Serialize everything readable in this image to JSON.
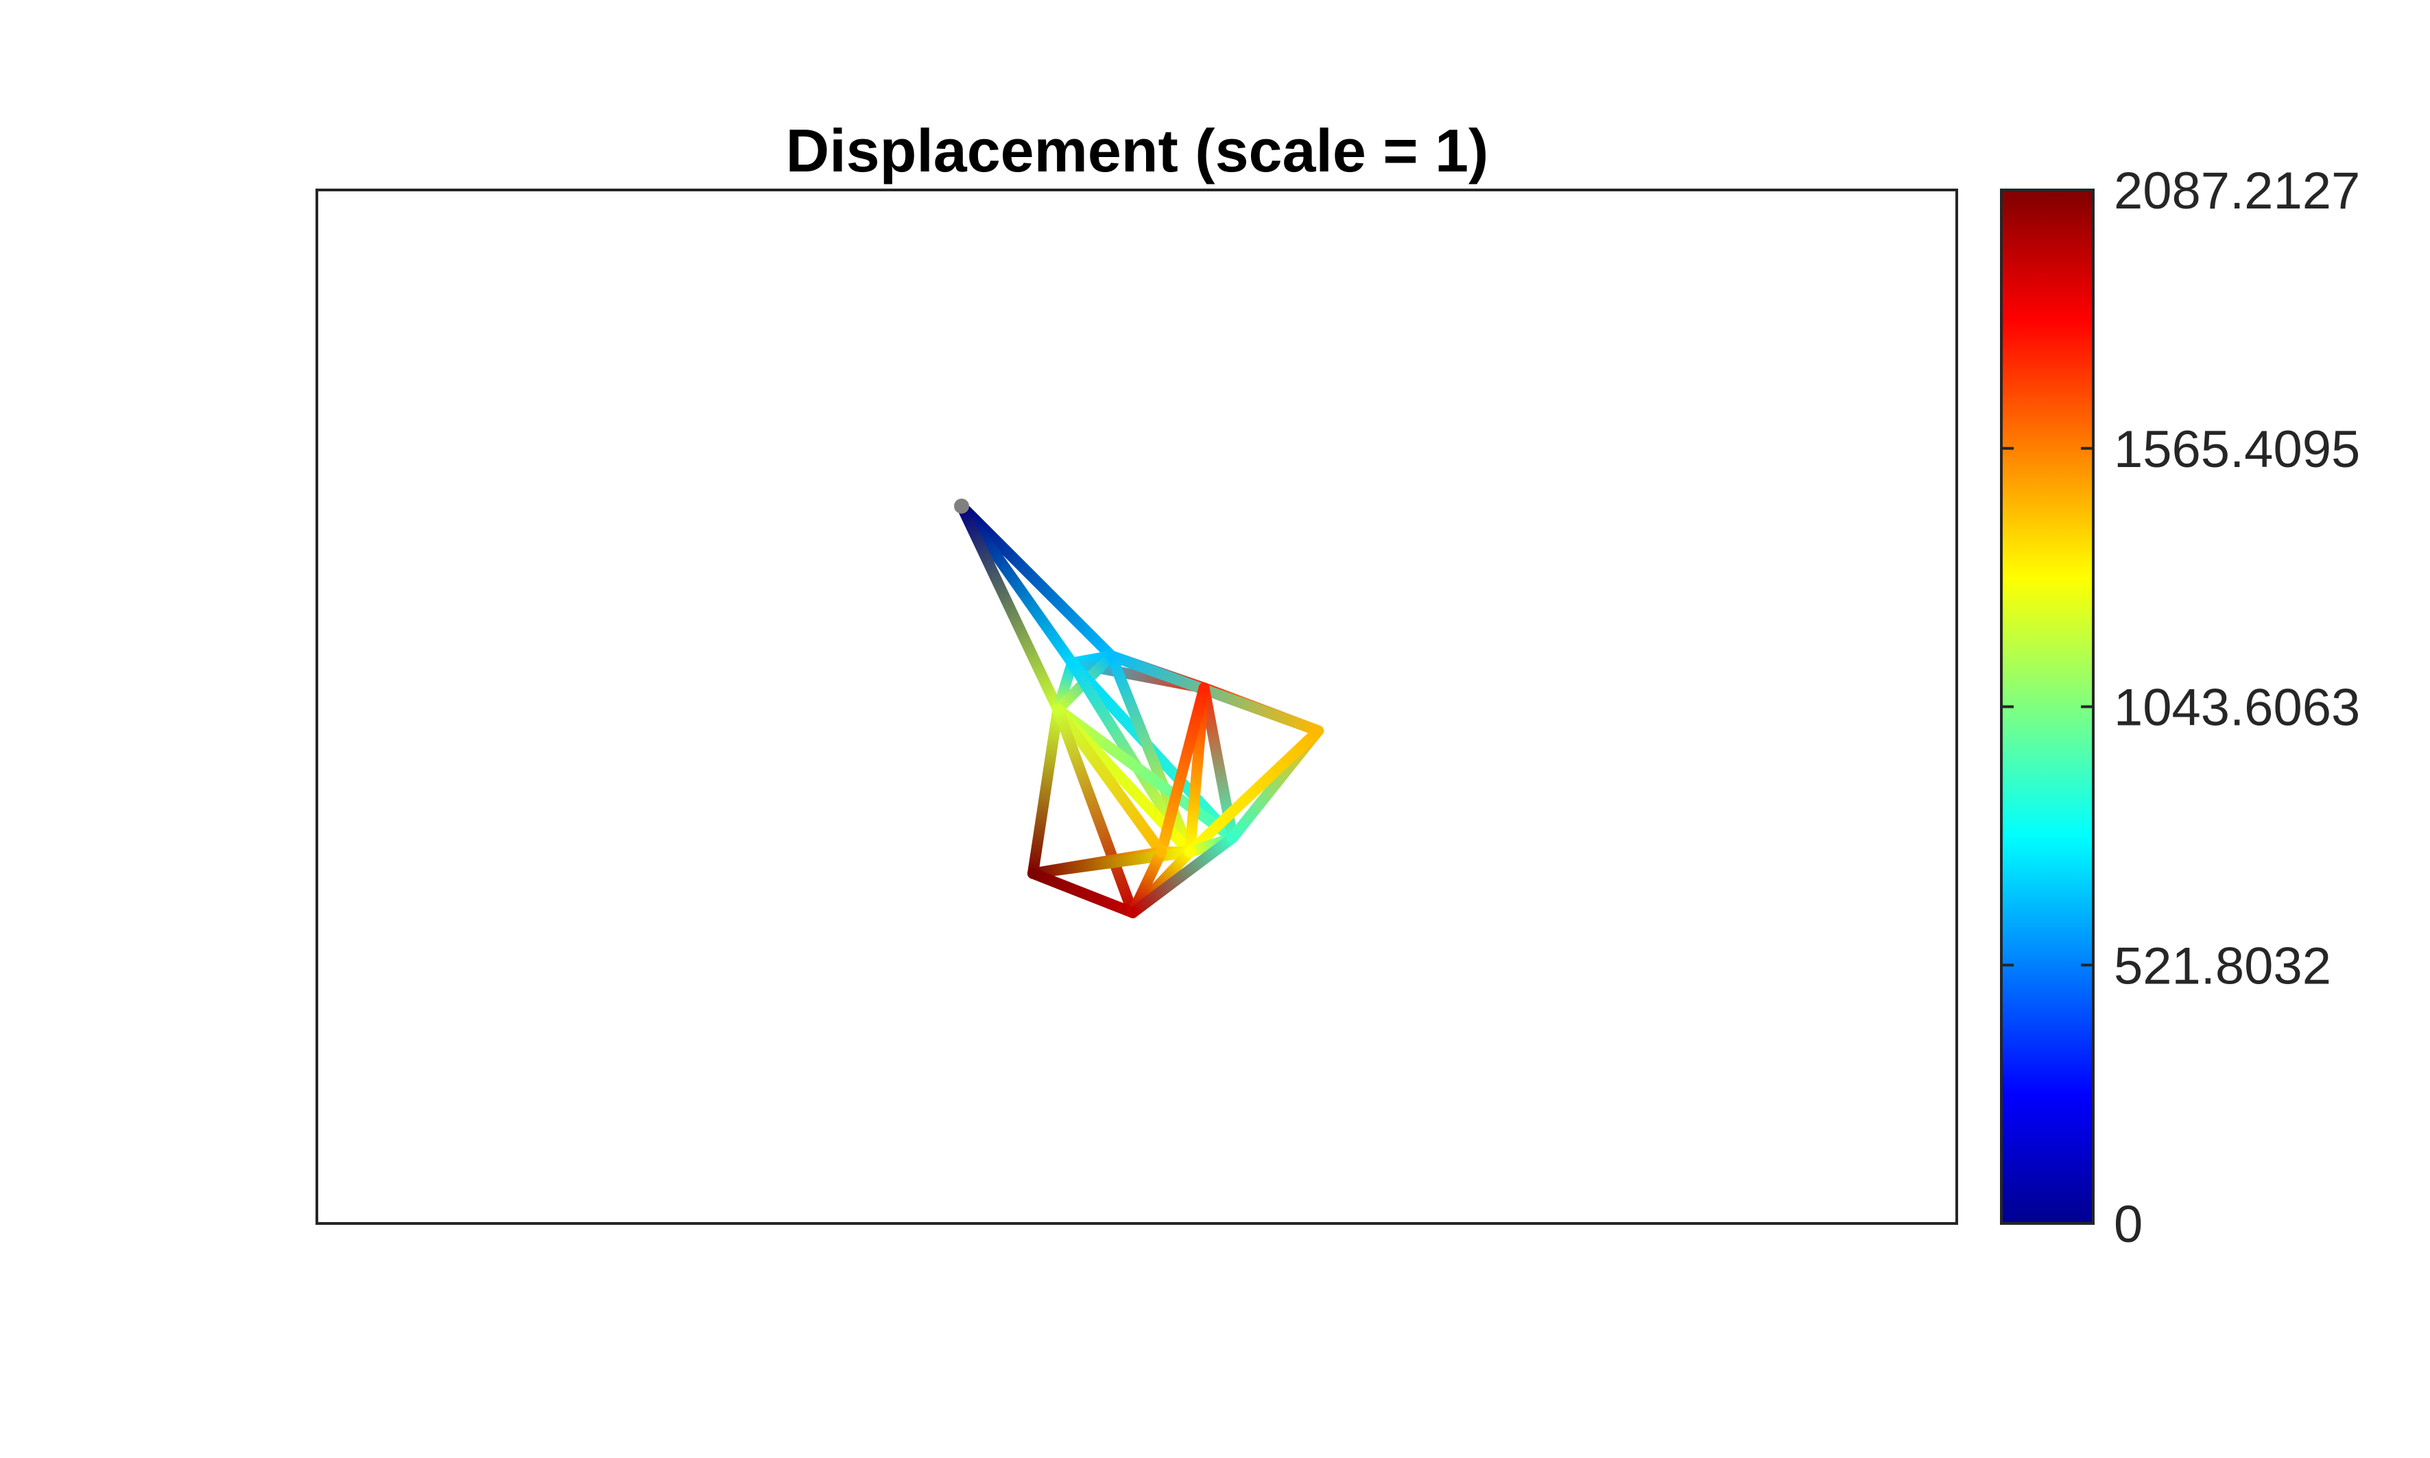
{
  "chart_data": {
    "type": "truss-deformation",
    "title": "Displacement (scale = 1)",
    "colormap": "jet",
    "colorbar": {
      "position": "right",
      "min": 0,
      "max": 2087.2127,
      "ticks": [
        0,
        521.8032,
        1043.6063,
        1565.4095,
        2087.2127
      ],
      "tick_labels": [
        "0",
        "521.8032",
        "1043.6063",
        "1565.4095",
        "2087.2127"
      ]
    },
    "axes_visible": false,
    "nodes": [
      {
        "id": 1,
        "x": 0.0,
        "y": 0.0,
        "disp": 0
      },
      {
        "id": 2,
        "x": 0.42,
        "y": -0.42,
        "disp": 650
      },
      {
        "id": 3,
        "x": 0.31,
        "y": -0.44,
        "disp": 700
      },
      {
        "id": 4,
        "x": 0.68,
        "y": -0.51,
        "disp": 1750
      },
      {
        "id": 5,
        "x": 1.0,
        "y": -0.63,
        "disp": 1450
      },
      {
        "id": 6,
        "x": 0.27,
        "y": -0.57,
        "disp": 1200
      },
      {
        "id": 7,
        "x": 0.76,
        "y": -0.93,
        "disp": 900
      },
      {
        "id": 8,
        "x": 0.64,
        "y": -0.97,
        "disp": 1300
      },
      {
        "id": 9,
        "x": 0.56,
        "y": -0.97,
        "disp": 1450
      },
      {
        "id": 10,
        "x": 0.2,
        "y": -1.03,
        "disp": 2087
      },
      {
        "id": 11,
        "x": 0.48,
        "y": -1.14,
        "disp": 1950
      }
    ],
    "elements": [
      [
        1,
        2
      ],
      [
        1,
        3
      ],
      [
        1,
        6
      ],
      [
        2,
        3
      ],
      [
        2,
        4
      ],
      [
        3,
        4
      ],
      [
        4,
        5
      ],
      [
        2,
        5
      ],
      [
        3,
        6
      ],
      [
        2,
        6
      ],
      [
        3,
        7
      ],
      [
        3,
        8
      ],
      [
        2,
        8
      ],
      [
        6,
        7
      ],
      [
        6,
        8
      ],
      [
        4,
        7
      ],
      [
        4,
        8
      ],
      [
        4,
        9
      ],
      [
        5,
        7
      ],
      [
        5,
        8
      ],
      [
        6,
        9
      ],
      [
        6,
        10
      ],
      [
        6,
        11
      ],
      [
        7,
        8
      ],
      [
        8,
        9
      ],
      [
        9,
        10
      ],
      [
        8,
        10
      ],
      [
        8,
        11
      ],
      [
        10,
        11
      ],
      [
        9,
        11
      ],
      [
        7,
        11
      ]
    ]
  }
}
